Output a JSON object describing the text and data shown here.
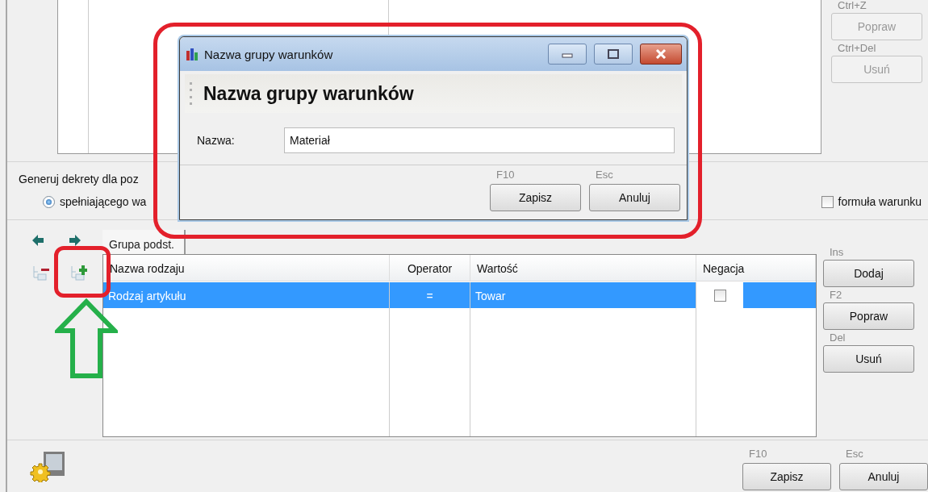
{
  "main_form": {
    "top_actions": [
      {
        "shortcut": "Ctrl+Z",
        "label": "Popraw",
        "disabled": true
      },
      {
        "shortcut": "Ctrl+Del",
        "label": "Usuń",
        "disabled": true
      }
    ],
    "group_title": "Generuj dekrety dla poz",
    "radio": {
      "label": "spełniającego wa",
      "selected": true
    },
    "formula_checkbox": {
      "label": "formuła warunku",
      "checked": false
    },
    "tabs": [
      {
        "label": "Grupa podst.",
        "selected": true
      }
    ],
    "table": {
      "columns": [
        "Nazwa rodzaju",
        "Operator",
        "Wartość",
        "Negacja"
      ],
      "rows": [
        {
          "name": "Rodzaj artykułu",
          "operator": "=",
          "value": "Towar",
          "negation": false,
          "selected": true
        }
      ]
    },
    "row_actions": [
      {
        "shortcut": "Ins",
        "label": "Dodaj",
        "disabled": false
      },
      {
        "shortcut": "F2",
        "label": "Popraw",
        "disabled": false
      },
      {
        "shortcut": "Del",
        "label": "Usuń",
        "disabled": false
      }
    ],
    "footer_actions": [
      {
        "shortcut": "F10",
        "label": "Zapisz"
      },
      {
        "shortcut": "Esc",
        "label": "Anuluj"
      }
    ]
  },
  "dialog": {
    "title": "Nazwa grupy warunków",
    "heading": "Nazwa grupy warunków",
    "field": {
      "label": "Nazwa:",
      "value": "Materiał"
    },
    "actions": [
      {
        "shortcut": "F10",
        "label": "Zapisz"
      },
      {
        "shortcut": "Esc",
        "label": "Anuluj"
      }
    ]
  },
  "annotations": [
    {
      "kind": "frame",
      "color": "#e3202b"
    },
    {
      "kind": "frame",
      "color": "#e3202b"
    },
    {
      "kind": "arrow",
      "color": "#25b04a"
    }
  ]
}
